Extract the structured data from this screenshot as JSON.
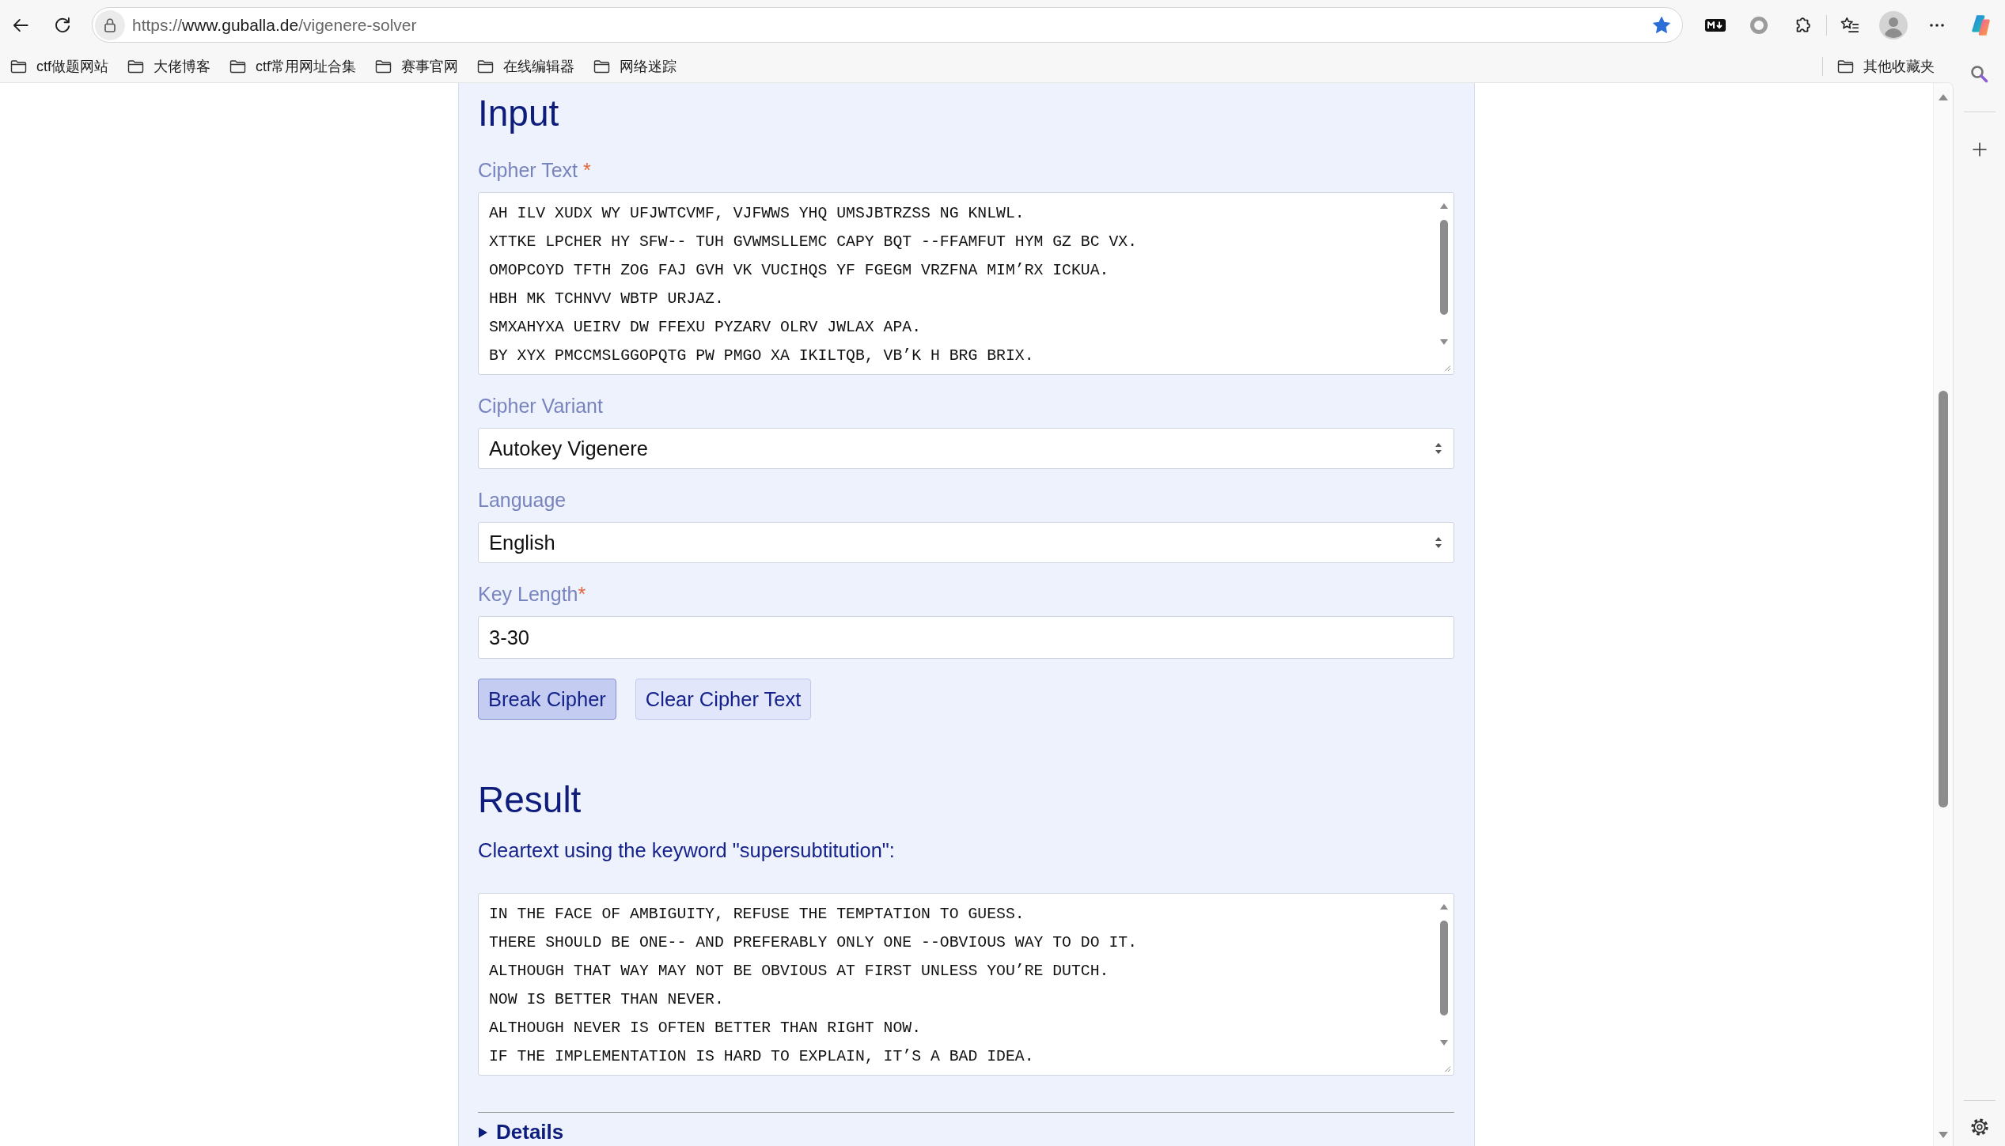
{
  "browser": {
    "url": {
      "scheme": "https://",
      "host": "www.guballa.de",
      "path": "/vigenere-solver"
    },
    "bookmarked": true,
    "bookmarks": [
      "ctf做题网站",
      "大佬博客",
      "ctf常用网址合集",
      "赛事官网",
      "在线编辑器",
      "网络迷踪"
    ],
    "other_bookmarks": "其他收藏夹"
  },
  "input": {
    "heading": "Input",
    "fields": [
      {
        "kind": "textarea",
        "label": "Cipher Text",
        "required_mark": " *",
        "lines": [
          "AH ILV XUDX WY UFJWTCVMF, VJFWWS YHQ UMSJBTRZSS NG KNLWL.",
          "XTTKE LPCHER HY SFW-- TUH GVWMSLLEMC CAPY BQT --FFAMFUT HYM GZ BC VX.",
          "OMOPCOYD TFTH ZOG FAJ GVH VK VUCIHQS YF FGEGM VRZFNA MIM’RX ICKUA.",
          "HBH MK TCHNVV WBTP URJAZ.",
          "SMXAHYXA UEIRV DW FFEXU PYZARV OLRV JWLAX APA.",
          "BY XYX PMCCMSLGGOPQTG PW PMGO XA IKILTQB, VB’K H BRG BRIX."
        ]
      },
      {
        "kind": "select",
        "label": "Cipher Variant",
        "value": "Autokey Vigenere"
      },
      {
        "kind": "select",
        "label": "Language",
        "value": "English"
      },
      {
        "kind": "text",
        "label": "Key Length",
        "required_mark": "*",
        "value": "3-30"
      }
    ],
    "buttons": [
      {
        "label": "Break Cipher",
        "kind": "primary"
      },
      {
        "label": "Clear Cipher Text",
        "kind": "secondary"
      }
    ]
  },
  "result": {
    "heading": "Result",
    "description": "Cleartext using the keyword \"supersubtitution\":",
    "output": {
      "kind": "textarea",
      "lines": [
        "IN THE FACE OF AMBIGUITY, REFUSE THE TEMPTATION TO GUESS.",
        "THERE SHOULD BE ONE-- AND PREFERABLY ONLY ONE --OBVIOUS WAY TO DO IT.",
        "ALTHOUGH THAT WAY MAY NOT BE OBVIOUS AT FIRST UNLESS YOU’RE DUTCH.",
        "NOW IS BETTER THAN NEVER.",
        "ALTHOUGH NEVER IS OFTEN BETTER THAN RIGHT NOW.",
        "IF THE IMPLEMENTATION IS HARD TO EXPLAIN, IT’S A BAD IDEA."
      ]
    },
    "details": {
      "label": "Details",
      "expanded": false
    }
  }
}
